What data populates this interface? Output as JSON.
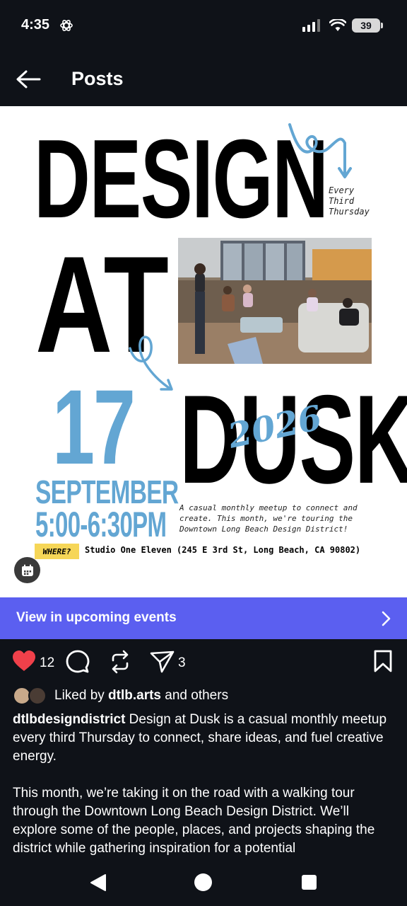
{
  "status_bar": {
    "time": "4:35",
    "battery": "39",
    "icons": [
      "signal-icon",
      "wifi-icon",
      "battery-icon"
    ]
  },
  "app_bar": {
    "title": "Posts"
  },
  "poster": {
    "word_design": "DESIGN",
    "word_at": "AT",
    "word_dusk": "DUSK",
    "tagline": "Every\nThird\nThursday",
    "day": "17",
    "month": "SEPTEMBER",
    "time": "5:00-6:30PM",
    "year": "2026",
    "description": "A casual monthly meetup to connect and\ncreate. This month, we're touring the\nDowntown Long Beach Design District!",
    "where_label": "WHERE?",
    "address": "Studio One Eleven (245 E 3rd St, Long Beach, CA 90802)",
    "colors": {
      "accent_blue": "#63a6d3",
      "where_yellow": "#f6d657"
    }
  },
  "events_banner": {
    "label": "View in upcoming events",
    "color": "#5b5ff0"
  },
  "actions": {
    "like_count": "12",
    "share_count": "3",
    "like_color": "#f0404a"
  },
  "likes": {
    "prefix": "Liked by ",
    "user": "dtlb.arts",
    "suffix": " and others"
  },
  "caption": {
    "username": "dtlbdesigndistrict",
    "text_1": " Design at Dusk is a casual monthly meetup every third Thursday to connect, share ideas, and fuel creative energy.",
    "text_2": "This month, we’re taking it on the road with a walking tour through the Downtown Long Beach Design District. We’ll explore some of the people, places, and projects shaping the district while gathering inspiration for a potential"
  }
}
